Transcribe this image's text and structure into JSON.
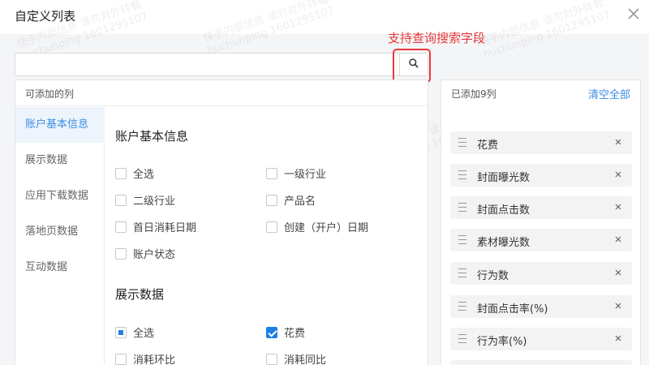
{
  "dialog": {
    "title": "自定义列表",
    "close_icon": "close-icon"
  },
  "annotation": {
    "text": "支持查询搜索字段",
    "color": "#e8393a"
  },
  "search": {
    "value": "",
    "placeholder": "",
    "button_icon": "search-icon"
  },
  "available": {
    "header": "可添加的列",
    "categories": [
      {
        "label": "账户基本信息",
        "active": true
      },
      {
        "label": "展示数据",
        "active": false
      },
      {
        "label": "应用下载数据",
        "active": false
      },
      {
        "label": "落地页数据",
        "active": false
      },
      {
        "label": "互动数据",
        "active": false
      }
    ],
    "sections": [
      {
        "title": "账户基本信息",
        "options": [
          {
            "label": "全选",
            "state": "unchecked"
          },
          {
            "label": "一级行业",
            "state": "unchecked"
          },
          {
            "label": "二级行业",
            "state": "unchecked"
          },
          {
            "label": "产品名",
            "state": "unchecked"
          },
          {
            "label": "首日消耗日期",
            "state": "unchecked"
          },
          {
            "label": "创建（开户）日期",
            "state": "unchecked"
          },
          {
            "label": "账户状态",
            "state": "unchecked"
          }
        ]
      },
      {
        "title": "展示数据",
        "options": [
          {
            "label": "全选",
            "state": "partial"
          },
          {
            "label": "花费",
            "state": "checked"
          },
          {
            "label": "消耗环比",
            "state": "unchecked"
          },
          {
            "label": "消耗同比",
            "state": "unchecked"
          }
        ]
      }
    ]
  },
  "selected": {
    "header": "已添加9列",
    "clear_label": "清空全部",
    "items": [
      "花费",
      "封面曝光数",
      "封面点击数",
      "素材曝光数",
      "行为数",
      "封面点击率(%)",
      "行为率(%)"
    ]
  },
  "watermark": {
    "line1": "快手内部信息 请勿对外转载",
    "line2": "huchunping 1601295107"
  },
  "colors": {
    "accent": "#1e7fe3",
    "link": "#3a8ee6",
    "annotation": "#e8393a",
    "active_category_bg": "#eef4fb"
  }
}
